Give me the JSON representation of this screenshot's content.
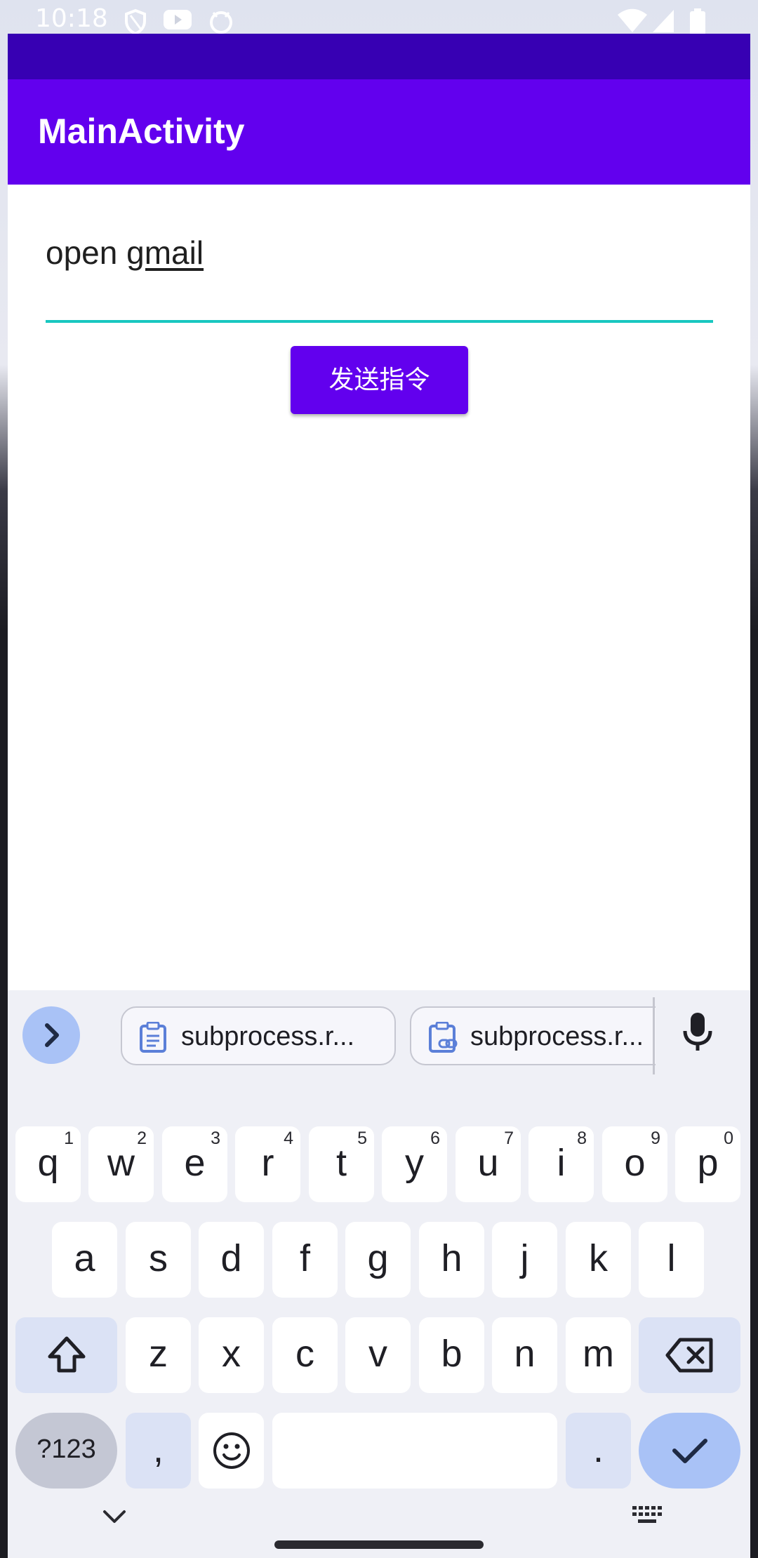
{
  "status_bar": {
    "time": "10:18"
  },
  "app": {
    "title": "MainActivity",
    "command_field": {
      "value_plain": "open ",
      "value_composing": "gmail"
    },
    "send_button": {
      "label": "发送指令"
    }
  },
  "keyboard": {
    "clipboard_chips": [
      {
        "label": "subprocess.r..."
      },
      {
        "label": "subprocess.r..."
      }
    ],
    "row1": [
      {
        "key": "q",
        "hint": "1"
      },
      {
        "key": "w",
        "hint": "2"
      },
      {
        "key": "e",
        "hint": "3"
      },
      {
        "key": "r",
        "hint": "4"
      },
      {
        "key": "t",
        "hint": "5"
      },
      {
        "key": "y",
        "hint": "6"
      },
      {
        "key": "u",
        "hint": "7"
      },
      {
        "key": "i",
        "hint": "8"
      },
      {
        "key": "o",
        "hint": "9"
      },
      {
        "key": "p",
        "hint": "0"
      }
    ],
    "row2": [
      "a",
      "s",
      "d",
      "f",
      "g",
      "h",
      "j",
      "k",
      "l"
    ],
    "row3": [
      "z",
      "x",
      "c",
      "v",
      "b",
      "n",
      "m"
    ],
    "row4": {
      "symbols": "?123",
      "comma": ",",
      "period": "."
    }
  },
  "colors": {
    "primary": "#6200ee",
    "primary_dark": "#3700b3",
    "field_underline": "#18c7c0",
    "keyboard_bg": "#eff0f6",
    "key_mod": "#dbe2f5",
    "key_accent": "#a9c2f6"
  }
}
